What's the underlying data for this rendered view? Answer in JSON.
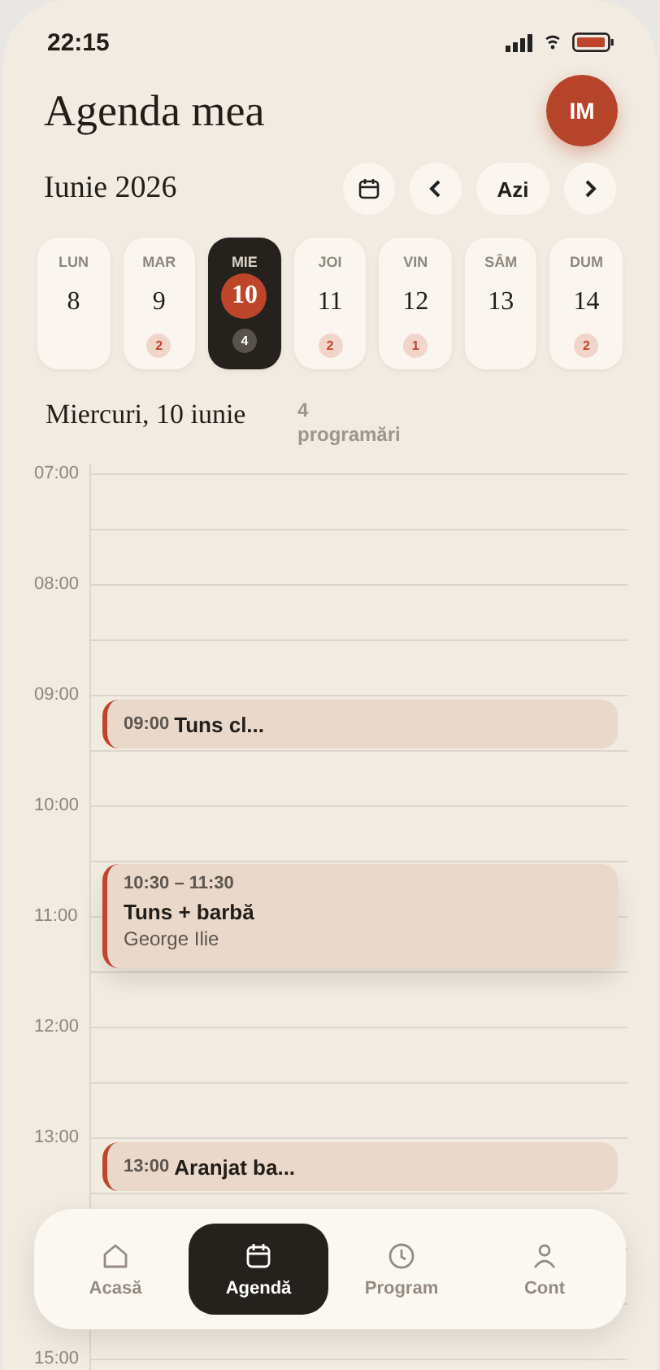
{
  "status_bar": {
    "time": "22:15"
  },
  "header": {
    "title": "Agenda mea",
    "avatar": "IM"
  },
  "month": {
    "label": "Iunie 2026",
    "today_button": "Azi"
  },
  "days": [
    {
      "weekday": "LUN",
      "date": "8",
      "selected": false
    },
    {
      "weekday": "MAR",
      "date": "9",
      "count": "2",
      "selected": false
    },
    {
      "weekday": "MIE",
      "date": "10",
      "count": "4",
      "selected": true
    },
    {
      "weekday": "JOI",
      "date": "11",
      "count": "2",
      "selected": false
    },
    {
      "weekday": "VIN",
      "date": "12",
      "count": "1",
      "selected": false
    },
    {
      "weekday": "SÂM",
      "date": "13",
      "selected": false
    },
    {
      "weekday": "DUM",
      "date": "14",
      "count": "2",
      "selected": false
    }
  ],
  "day_heading": {
    "title": "Miercuri, 10 iunie",
    "count": "4 programări"
  },
  "hours": [
    {
      "label": "07:00"
    },
    {
      "label": "08:00"
    },
    {
      "label": "09:00",
      "appointments": [
        {
          "kind": "compact",
          "time": "09:00",
          "title": "Tuns cl..."
        }
      ]
    },
    {
      "label": "10:00",
      "appointments": [
        {
          "kind": "detailed",
          "time": "10:30 – 11:30",
          "title": "Tuns + barbă",
          "client": "George Ilie"
        }
      ]
    },
    {
      "label": "11:00"
    },
    {
      "label": "12:00"
    },
    {
      "label": "13:00",
      "appointments": [
        {
          "kind": "compact",
          "time": "13:00",
          "title": "Aranjat ba..."
        }
      ]
    }
  ],
  "last_hour": "15:00",
  "nav": [
    {
      "label": "Acasă",
      "selected": false
    },
    {
      "label": "Agendă",
      "selected": true
    },
    {
      "label": "Program",
      "selected": false
    },
    {
      "label": "Cont",
      "selected": false
    }
  ]
}
